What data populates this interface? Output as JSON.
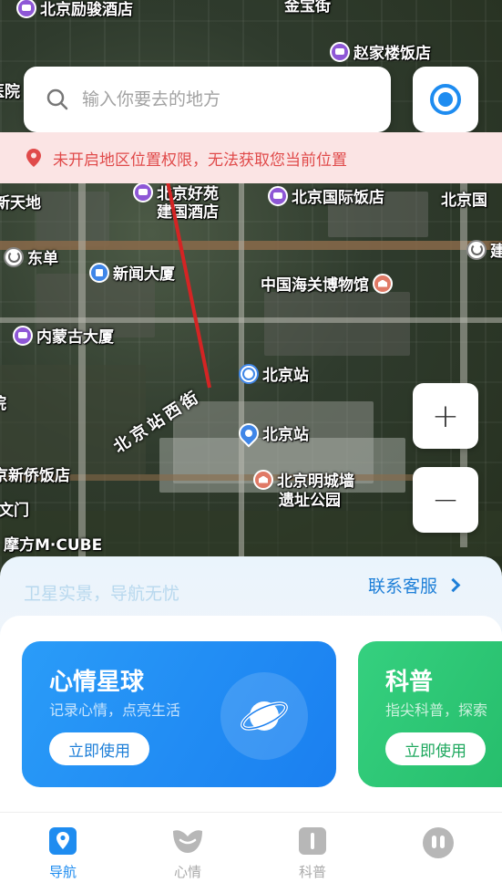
{
  "search": {
    "placeholder": "输入你要去的地方"
  },
  "alert": {
    "text": "未开启地区位置权限，无法获取您当前位置"
  },
  "map": {
    "pois": [
      {
        "label": "北京励骏酒店",
        "icon": "hotel-icon"
      },
      {
        "label": "金宝街",
        "icon": "street-label"
      },
      {
        "label": "赵家楼饭店",
        "icon": "hotel-icon"
      },
      {
        "label": "医院",
        "icon": "none"
      },
      {
        "label": "新天地",
        "icon": "none"
      },
      {
        "label": "北京好苑",
        "icon": "hotel-icon"
      },
      {
        "label": "建国酒店",
        "icon": "none"
      },
      {
        "label": "北京国际饭店",
        "icon": "hotel-icon"
      },
      {
        "label": "北京国",
        "icon": "none"
      },
      {
        "label": "东单",
        "icon": "transfer-icon"
      },
      {
        "label": "建",
        "icon": "transfer-icon"
      },
      {
        "label": "新闻大厦",
        "icon": "building-icon"
      },
      {
        "label": "中国海关博物馆",
        "icon": "museum-icon"
      },
      {
        "label": "内蒙古大厦",
        "icon": "hotel-icon"
      },
      {
        "label": "北京站",
        "icon": "metro-icon"
      },
      {
        "label": "北京站",
        "icon": "station-icon"
      },
      {
        "label": "院",
        "icon": "none"
      },
      {
        "label": "京新侨饭店",
        "icon": "none"
      },
      {
        "label": "北京明城墙",
        "icon": "museum-icon"
      },
      {
        "label": "遗址公园",
        "icon": "none"
      },
      {
        "label": "文门",
        "icon": "none"
      },
      {
        "label": "摩方M·CUBE",
        "icon": "none"
      }
    ],
    "street": "北京站西街",
    "zoom_in": "+",
    "zoom_out": "−"
  },
  "sheet": {
    "tagline": "卫星实景，导航无忧",
    "service": "联系客服",
    "cards": [
      {
        "title": "心情星球",
        "subtitle": "记录心情，点亮生活",
        "button": "立即使用",
        "color": "#1a7ff0"
      },
      {
        "title": "科普",
        "subtitle": "指尖科普，探索",
        "button": "立即使用",
        "color": "#22b866"
      }
    ]
  },
  "tabs": [
    {
      "label": "导航",
      "icon": "map-pin-icon",
      "active": true
    },
    {
      "label": "心情",
      "icon": "heart-icon",
      "active": false
    },
    {
      "label": "科普",
      "icon": "book-icon",
      "active": false
    },
    {
      "label": "",
      "icon": "profile-icon",
      "active": false
    }
  ],
  "colors": {
    "accent": "#1e8cf0",
    "alert_bg": "#fbe4e4",
    "alert_text": "#e04a4a",
    "card_blue": "#1a7ff0",
    "card_green": "#22b866"
  }
}
